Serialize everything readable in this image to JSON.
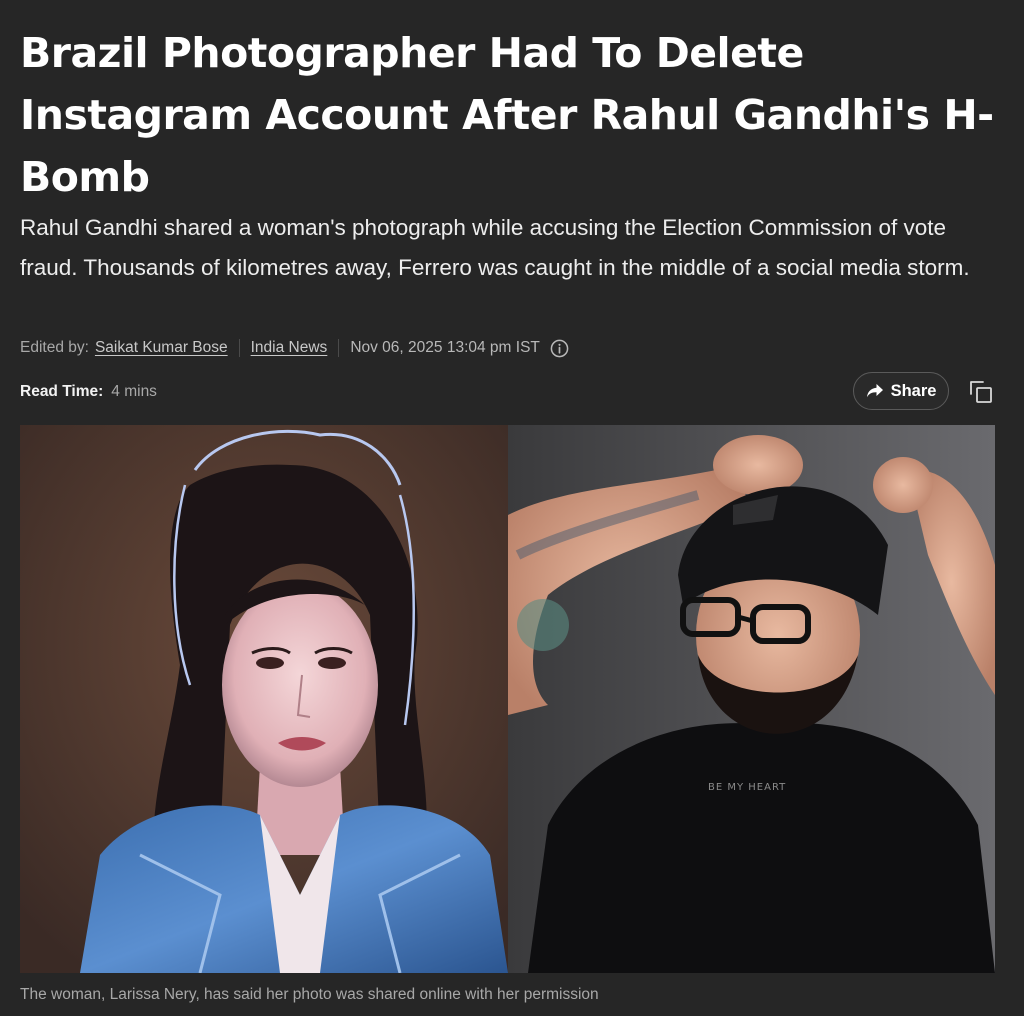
{
  "article": {
    "headline": "Brazil Photographer Had To Delete Instagram Account After Rahul Gandhi's H-Bomb",
    "summary": "Rahul Gandhi shared a woman's photograph while accusing the Election Commission of vote fraud. Thousands of kilometres away, Ferrero was caught in the middle of a social media storm.",
    "meta": {
      "edited_by_label": "Edited by:",
      "editor": "Saikat Kumar Bose",
      "category": "India News",
      "datetime": "Nov 06, 2025 13:04 pm IST",
      "info_icon": "info-circle-icon"
    },
    "read_time": {
      "label": "Read Time:",
      "value": "4 mins"
    },
    "actions": {
      "share_label": "Share",
      "share_icon": "share-arrow-icon",
      "copy_icon": "copy-icon"
    },
    "image": {
      "left_description_icon": "woman-portrait",
      "right_description_icon": "man-portrait"
    },
    "caption": "The woman, Larissa Nery, has said her photo was shared online with her permission"
  },
  "colors": {
    "background": "#262626",
    "text_primary": "#ffffff",
    "text_secondary": "#a8a8a8",
    "button_border": "#5a5a5a"
  }
}
